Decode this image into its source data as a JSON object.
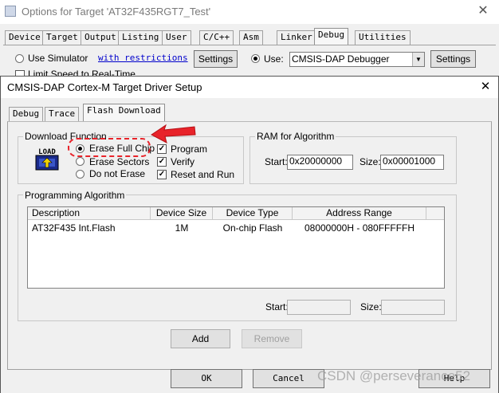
{
  "outer": {
    "title": "Options for Target 'AT32F435RGT7_Test'",
    "close": "✕",
    "tabs": [
      "Device",
      "Target",
      "Output",
      "Listing",
      "User",
      "C/C++",
      "Asm",
      "Linker",
      "Debug",
      "Utilities"
    ],
    "use_simulator": "Use Simulator",
    "with_restrictions": "with restrictions",
    "settings": "Settings",
    "limit_speed": "Limit Speed to Real-Time",
    "use": "Use:",
    "debugger": "CMSIS-DAP Debugger",
    "ok": "OK",
    "cancel": "Cancel",
    "help": "Help"
  },
  "dialog": {
    "title": "CMSIS-DAP Cortex-M Target Driver Setup",
    "close": "✕",
    "tabs": [
      "Debug",
      "Trace",
      "Flash Download"
    ],
    "download_function": {
      "label": "Download Function",
      "load_icon_text": "LOAD",
      "erase_full_chip": "Erase Full Chip",
      "erase_sectors": "Erase Sectors",
      "do_not_erase": "Do not Erase",
      "program": "Program",
      "verify": "Verify",
      "reset_and_run": "Reset and Run"
    },
    "ram": {
      "label": "RAM for Algorithm",
      "start_label": "Start:",
      "start_value": "0x20000000",
      "size_label": "Size:",
      "size_value": "0x00001000"
    },
    "programming_algorithm": {
      "label": "Programming Algorithm",
      "columns": [
        "Description",
        "Device Size",
        "Device Type",
        "Address Range"
      ],
      "rows": [
        [
          "AT32F435 Int.Flash",
          "1M",
          "On-chip Flash",
          "08000000H - 080FFFFFH"
        ]
      ],
      "start_label": "Start:",
      "size_label": "Size:",
      "start_value": "",
      "size_value": ""
    },
    "add": "Add",
    "remove": "Remove"
  },
  "watermark": "CSDN @perseverance52",
  "colors": {
    "annotation": "#e8232a"
  }
}
